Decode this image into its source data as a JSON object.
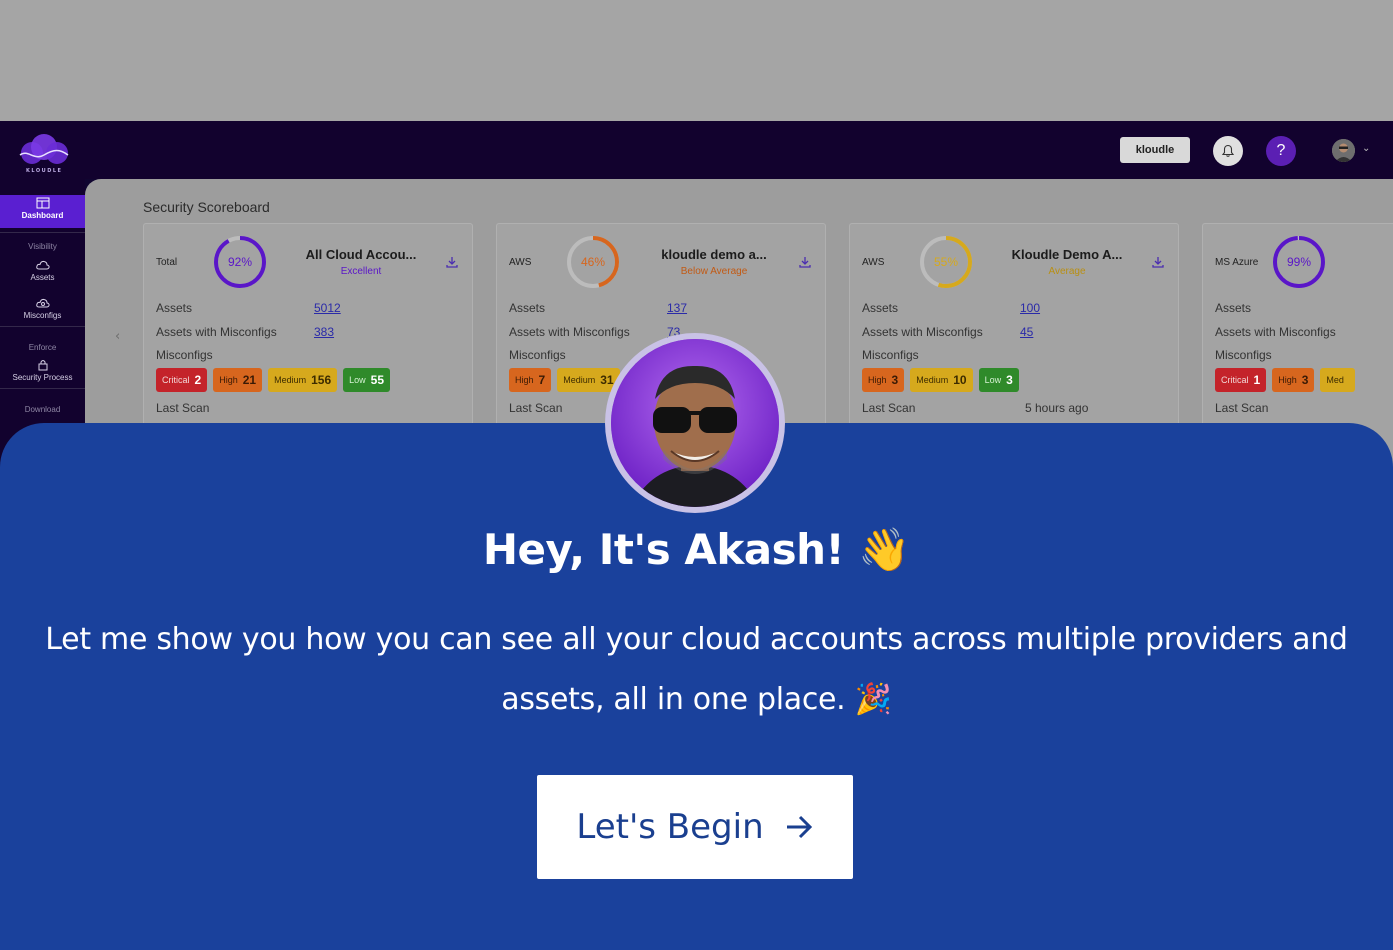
{
  "app": {
    "logo_text": "KLOUDLE",
    "org_button": "kloudle",
    "help_label": "?"
  },
  "sidebar": {
    "items": [
      {
        "label": "Dashboard",
        "icon": "dashboard-icon",
        "active": true
      },
      {
        "section": "Visibility"
      },
      {
        "label": "Assets",
        "icon": "cloud-icon"
      },
      {
        "label": "Misconfigs",
        "icon": "cloud-settings-icon"
      },
      {
        "section": "Enforce"
      },
      {
        "label": "Security Process",
        "icon": "lock-icon"
      },
      {
        "section": "Download"
      }
    ]
  },
  "scoreboard": {
    "title": "Security Scoreboard",
    "labels": {
      "assets": "Assets",
      "assets_with_misconfigs": "Assets with Misconfigs",
      "misconfigs": "Misconfigs",
      "last_scan": "Last Scan"
    },
    "cards": [
      {
        "provider": "Total",
        "percent": "92%",
        "score": 92,
        "ring_color": "#5a16c8",
        "account": "All Cloud Accou...",
        "rating": "Excellent",
        "rating_color": "#5a16c8",
        "assets": "5012",
        "assets_misconfigs": "383",
        "badges": [
          {
            "label": "Critical",
            "count": "2",
            "type": "crit"
          },
          {
            "label": "High",
            "count": "21",
            "type": "high"
          },
          {
            "label": "Medium",
            "count": "156",
            "type": "med"
          },
          {
            "label": "Low",
            "count": "55",
            "type": "low"
          }
        ],
        "last_scan": ""
      },
      {
        "provider": "AWS",
        "percent": "46%",
        "score": 46,
        "ring_color": "#d7661e",
        "account": "kloudle demo a...",
        "rating": "Below Average",
        "rating_color": "#c25a14",
        "assets": "137",
        "assets_misconfigs": "73",
        "badges": [
          {
            "label": "High",
            "count": "7",
            "type": "high"
          },
          {
            "label": "Medium",
            "count": "31",
            "type": "med"
          }
        ],
        "last_scan": ""
      },
      {
        "provider": "AWS",
        "percent": "55%",
        "score": 55,
        "ring_color": "#d6a91d",
        "account": "Kloudle Demo A...",
        "rating": "Average",
        "rating_color": "#b98f12",
        "assets": "100",
        "assets_misconfigs": "45",
        "badges": [
          {
            "label": "High",
            "count": "3",
            "type": "high"
          },
          {
            "label": "Medium",
            "count": "10",
            "type": "med"
          },
          {
            "label": "Low",
            "count": "3",
            "type": "low"
          }
        ],
        "last_scan": "5 hours ago"
      },
      {
        "provider": "MS Azure",
        "percent": "99%",
        "score": 99,
        "ring_color": "#5a16c8",
        "account": "",
        "rating": "",
        "rating_color": "#5a16c8",
        "assets": "",
        "assets_misconfigs": "",
        "badges": [
          {
            "label": "Critical",
            "count": "1",
            "type": "crit"
          },
          {
            "label": "High",
            "count": "3",
            "type": "high"
          },
          {
            "label": "Med",
            "count": "",
            "type": "med"
          }
        ],
        "last_scan": ""
      }
    ]
  },
  "overlay": {
    "greeting": "Hey, It's Akash! 👋",
    "message": "Let me show you how you can see all your cloud accounts across multiple providers and assets, all in one place. 🎉",
    "button_label": "Let's Begin",
    "button_icon": "arrow-right-icon"
  }
}
